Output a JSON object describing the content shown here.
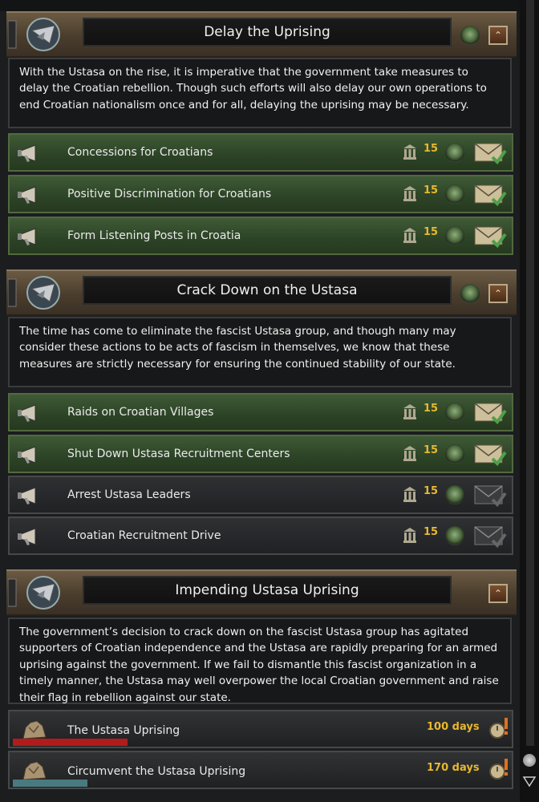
{
  "categories": [
    {
      "title": "Delay the Uprising",
      "description": "With the Ustasa on the rise, it is imperative that the government take measures to delay the Croatian rebellion. Though such efforts will also delay our own operations to end Croatian nationalism once and for all, delaying the uprising may be necessary.",
      "decisions": [
        {
          "label": "Concessions for Croatians",
          "cost": "15",
          "state": "available"
        },
        {
          "label": "Positive Discrimination for Croatians",
          "cost": "15",
          "state": "available"
        },
        {
          "label": "Form Listening Posts in Croatia",
          "cost": "15",
          "state": "available"
        }
      ]
    },
    {
      "title": "Crack Down on the Ustasa",
      "description": "The time has come to eliminate the fascist Ustasa group, and though many may consider these actions to be acts of fascism in themselves, we know that these measures are strictly necessary for ensuring the continued stability of our state.",
      "decisions": [
        {
          "label": "Raids on Croatian Villages",
          "cost": "15",
          "state": "available"
        },
        {
          "label": "Shut Down Ustasa Recruitment Centers",
          "cost": "15",
          "state": "available"
        },
        {
          "label": "Arrest Ustasa Leaders",
          "cost": "15",
          "state": "unavailable"
        },
        {
          "label": "Croatian Recruitment Drive",
          "cost": "15",
          "state": "unavailable"
        }
      ]
    },
    {
      "title": "Impending Ustasa Uprising",
      "description": "The government’s decision to crack down on the fascist Ustasa group has agitated supporters of Croatian independence and the Ustasa are rapidly preparing for an armed uprising against the government. If we fail to dismantle this fascist organization in a timely manner, the Ustasa may well overpower the local Croatian government and raise their flag in rebellion against our state.",
      "missions": [
        {
          "label": "The Ustasa Uprising",
          "days": "100 days",
          "progress": 0.23,
          "bar_color": "#b01c1c"
        },
        {
          "label": "Circumvent the Ustasa Uprising",
          "days": "170 days",
          "progress": 0.15,
          "bar_color": "#4a7a80"
        }
      ]
    }
  ],
  "colors": {
    "cost": "#e8b830",
    "available_row": "#2c4326",
    "unavailable_row": "#25272a"
  }
}
